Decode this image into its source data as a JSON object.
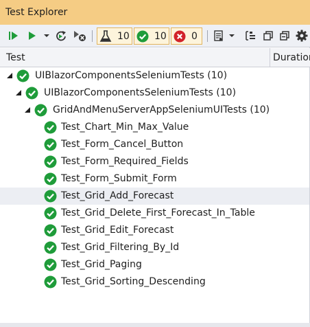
{
  "window": {
    "title": "Test Explorer"
  },
  "toolbar": {
    "passed_count": "10",
    "total_count": "10",
    "failed_count": "0",
    "icons": [
      "run-all-icon",
      "run-icon",
      "dropdown-icon",
      "repeat-run-icon",
      "cancel-run-icon",
      "flask-icon",
      "passed-icon",
      "failed-icon",
      "playlist-icon",
      "group-by-icon",
      "expand-all-icon",
      "collapse-all-icon",
      "settings-icon"
    ]
  },
  "columns": {
    "test": "Test",
    "duration": "Duration"
  },
  "colors": {
    "titlebar": "#f5cc84",
    "pass": "#1f9c3a",
    "fail": "#d2232a",
    "run": "#1f9c3a"
  },
  "tree": {
    "nodes": [
      {
        "level": 0,
        "label": "UIBlazorComponentsSeleniumTests",
        "count": "(10)"
      },
      {
        "level": 1,
        "label": "UIBlazorComponentsSeleniumTests",
        "count": "(10)"
      },
      {
        "level": 2,
        "label": "GridAndMenuServerAppSeleniumUITests",
        "count": "(10)"
      }
    ],
    "tests": [
      "Test_Chart_Min_Max_Value",
      "Test_Form_Cancel_Button",
      "Test_Form_Required_Fields",
      "Test_Form_Submit_Form",
      "Test_Grid_Add_Forecast",
      "Test_Grid_Delete_First_Forecast_In_Table",
      "Test_Grid_Edit_Forecast",
      "Test_Grid_Filtering_By_Id",
      "Test_Grid_Paging",
      "Test_Grid_Sorting_Descending"
    ]
  }
}
